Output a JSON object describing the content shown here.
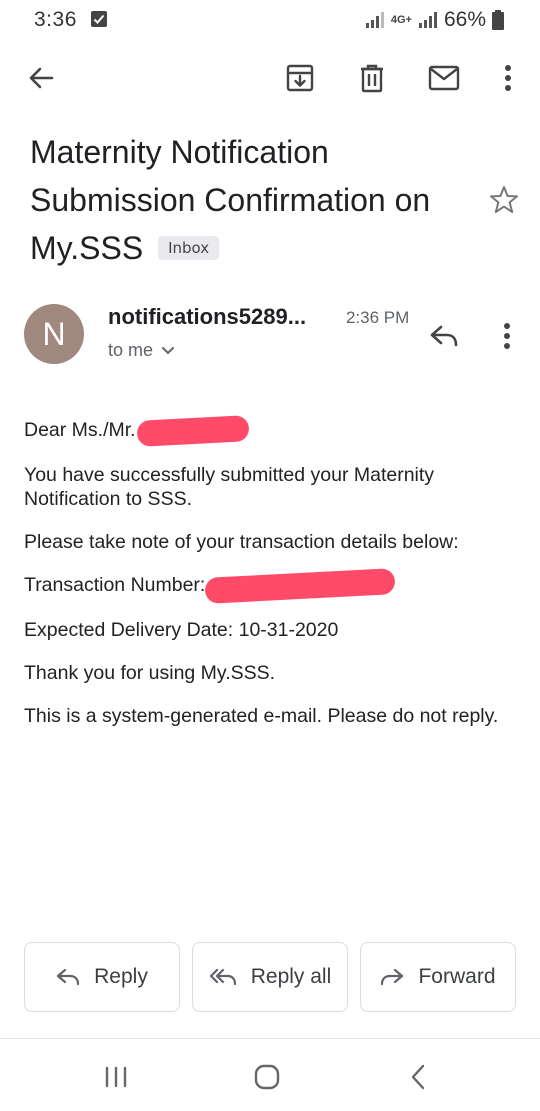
{
  "status": {
    "time": "3:36",
    "network": "4G+",
    "battery": "66%"
  },
  "toolbar": {
    "icons": [
      "back-arrow-icon",
      "archive-icon",
      "delete-icon",
      "mark-unread-icon",
      "more-vert-icon"
    ]
  },
  "email": {
    "subject": "Maternity Notification Submission Confirmation on My.SSS",
    "label": "Inbox",
    "sender_initial": "N",
    "sender": "notifications5289...",
    "time": "2:36 PM",
    "recipient": "to me",
    "body": {
      "greeting": "Dear Ms./Mr.",
      "line1": "You have successfully submitted your Maternity Notification to SSS.",
      "line2": "Please take note of your transaction details below:",
      "transaction_label": "Transaction Number:",
      "delivery": "Expected Delivery Date: 10-31-2020",
      "thanks": "Thank you for using My.SSS.",
      "footer": "This is a system-generated e-mail. Please do not reply."
    }
  },
  "actions": {
    "reply": "Reply",
    "reply_all": "Reply all",
    "forward": "Forward"
  },
  "colors": {
    "avatar": "#a1887f",
    "redaction": "#ff3b5c"
  }
}
